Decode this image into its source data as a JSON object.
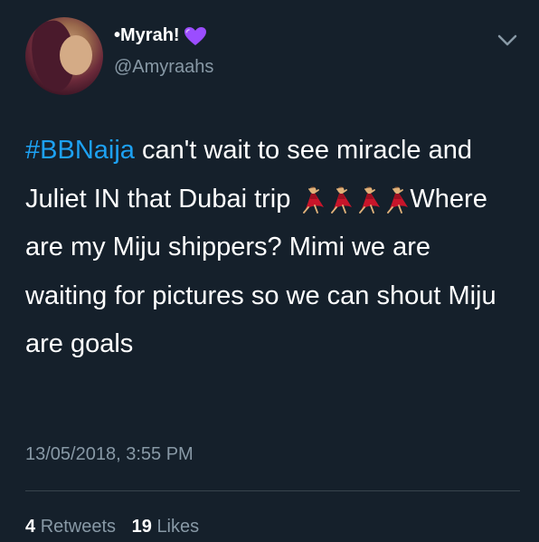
{
  "colors": {
    "background": "#15202b",
    "text": "#ffffff",
    "secondary": "#8899a6",
    "link": "#1da1f2",
    "divider": "#38444d",
    "heart": "#9b4dff"
  },
  "author": {
    "display_name": "•Myrah!",
    "badge_icon": "purple-heart-icon",
    "handle": "@Amyraahs"
  },
  "menu_icon": "chevron-down-icon",
  "tweet": {
    "hashtag": "#BBNaija",
    "text_part1": " can't wait to see miracle and Juliet IN that Dubai trip ",
    "emoji_icon": "dancing-woman-emoji",
    "emoji_count": 4,
    "text_part2": "Where are my Miju shippers? Mimi we are waiting for pictures so we can shout Miju are goals"
  },
  "timestamp": "13/05/2018, 3:55 PM",
  "stats": {
    "retweets_count": "4",
    "retweets_label": "Retweets",
    "likes_count": "19",
    "likes_label": "Likes"
  }
}
